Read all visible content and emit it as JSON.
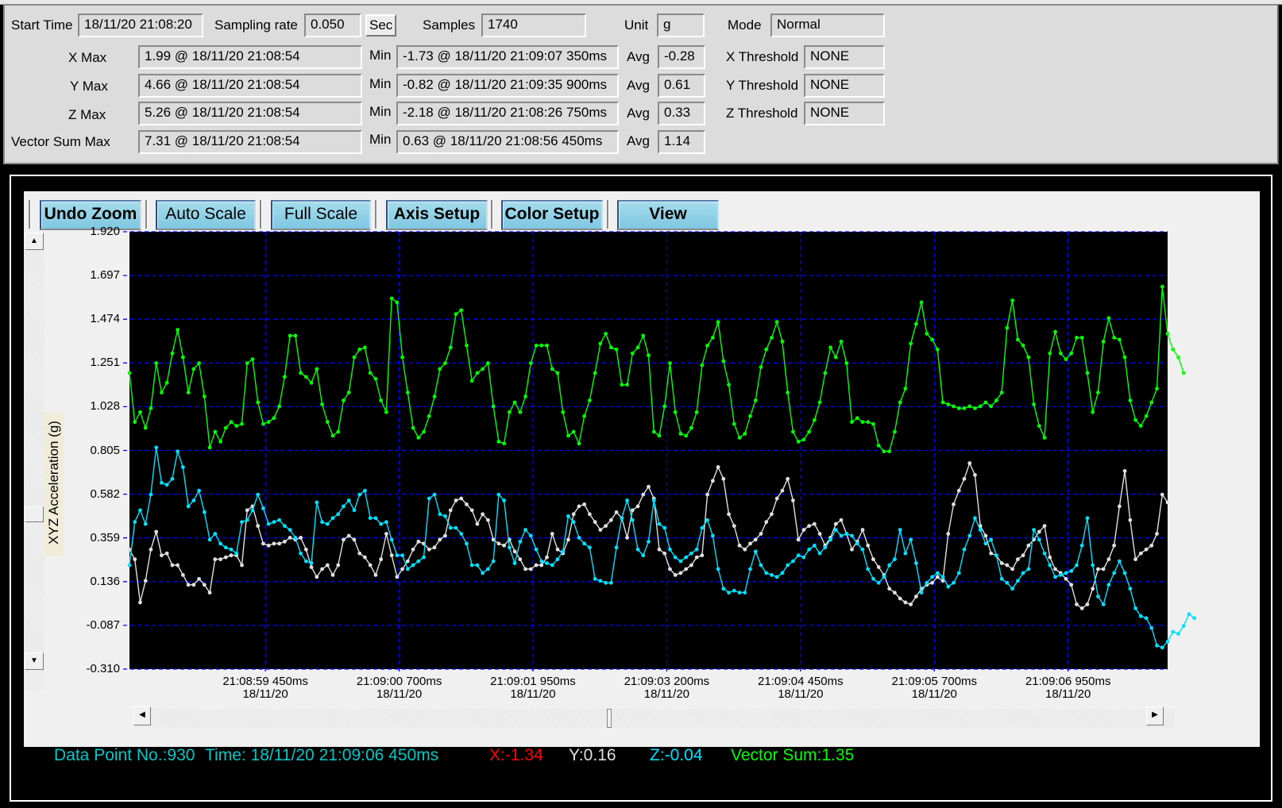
{
  "header": {
    "start_time_label": "Start Time",
    "start_time": "18/11/20 21:08:20",
    "sampling_rate_label": "Sampling rate",
    "sampling_rate": "0.050",
    "sampling_unit_button": "Sec",
    "samples_label": "Samples",
    "samples": "1740",
    "unit_label": "Unit",
    "unit": "g",
    "mode_label": "Mode",
    "mode": "Normal",
    "rows": [
      {
        "label": "X  Max",
        "max": "1.99 @ 18/11/20 21:08:54",
        "min_label": "Min",
        "min": "-1.73 @ 18/11/20 21:09:07 350ms",
        "avg_label": "Avg",
        "avg": "-0.28",
        "threshold_label": "X Threshold",
        "threshold": "NONE"
      },
      {
        "label": "Y Max",
        "max": "4.66 @ 18/11/20 21:08:54",
        "min_label": "Min",
        "min": "-0.82 @ 18/11/20 21:09:35 900ms",
        "avg_label": "Avg",
        "avg": "0.61",
        "threshold_label": "Y Threshold",
        "threshold": "NONE"
      },
      {
        "label": "Z  Max",
        "max": "5.26 @ 18/11/20 21:08:54",
        "min_label": "Min",
        "min": "-2.18 @ 18/11/20 21:08:26 750ms",
        "avg_label": "Avg",
        "avg": "0.33",
        "threshold_label": "Z Threshold",
        "threshold": "NONE"
      },
      {
        "label": "Vector Sum Max",
        "max": "7.31 @ 18/11/20 21:08:54",
        "min_label": "Min",
        "min": "0.63 @ 18/11/20 21:08:56 450ms",
        "avg_label": "Avg",
        "avg": "1.14"
      }
    ]
  },
  "toolbar": {
    "buttons": [
      "Undo Zoom",
      "Auto Scale",
      "Full Scale",
      "Axis Setup",
      "Color Setup",
      "View"
    ]
  },
  "status": {
    "data_point": "Data Point No.:930",
    "time": "Time: 18/11/20 21:09:06 450ms",
    "x": "X:-1.34",
    "y": "Y:0.16",
    "z": "Z:-0.04",
    "vector_sum": "Vector Sum:1.35",
    "colors": {
      "cyan": "#00c8c8",
      "x": "#ff0000",
      "y": "#e0e0e0",
      "z": "#00e0ff",
      "vector": "#00ff00"
    }
  },
  "chart_data": {
    "type": "line",
    "title": "",
    "ylabel": "XYZ  Acceleration (g)",
    "xlabel": "",
    "ylim": [
      -0.31,
      1.92
    ],
    "yticks": [
      "1.920",
      "1.697",
      "1.474",
      "1.251",
      "1.028",
      "0.805",
      "0.582",
      "0.359",
      "0.136",
      "-0.087",
      "-0.310"
    ],
    "xticks": [
      {
        "time": "21:08:59 450ms",
        "date": "18/11/20",
        "index": 25.4
      },
      {
        "time": "21:09:00 700ms",
        "date": "18/11/20",
        "index": 50.4
      },
      {
        "time": "21:09:01 950ms",
        "date": "18/11/20",
        "index": 75.4
      },
      {
        "time": "21:09:03 200ms",
        "date": "18/11/20",
        "index": 100.4
      },
      {
        "time": "21:09:04 450ms",
        "date": "18/11/20",
        "index": 125.4
      },
      {
        "time": "21:09:05 700ms",
        "date": "18/11/20",
        "index": 150.4
      },
      {
        "time": "21:09:06 950ms",
        "date": "18/11/20",
        "index": 175.4
      }
    ],
    "x_count": 195,
    "grid": true,
    "background": "#000000",
    "series": [
      {
        "name": "Vector Sum",
        "color": "#00ff00",
        "values": [
          1.2,
          0.95,
          1.0,
          0.92,
          1.02,
          1.25,
          1.1,
          1.15,
          1.3,
          1.42,
          1.28,
          1.1,
          1.22,
          1.25,
          1.08,
          0.82,
          0.9,
          0.85,
          0.92,
          0.95,
          0.93,
          0.94,
          1.25,
          1.27,
          1.05,
          0.94,
          0.95,
          0.97,
          1.03,
          1.18,
          1.39,
          1.39,
          1.2,
          1.18,
          1.15,
          1.22,
          1.04,
          0.95,
          0.88,
          0.9,
          1.06,
          1.1,
          1.28,
          1.32,
          1.33,
          1.2,
          1.17,
          1.06,
          1.0,
          1.58,
          1.56,
          1.28,
          1.1,
          0.92,
          0.87,
          0.9,
          0.98,
          1.08,
          1.22,
          1.25,
          1.33,
          1.5,
          1.52,
          1.34,
          1.16,
          1.2,
          1.22,
          1.25,
          1.03,
          0.85,
          0.84,
          1.0,
          1.05,
          1.0,
          1.08,
          1.25,
          1.34,
          1.34,
          1.34,
          1.22,
          1.2,
          1.0,
          0.88,
          0.9,
          0.84,
          0.98,
          1.06,
          1.2,
          1.35,
          1.4,
          1.33,
          1.32,
          1.14,
          1.14,
          1.3,
          1.33,
          1.39,
          1.29,
          0.9,
          0.88,
          1.03,
          1.25,
          1.0,
          0.89,
          0.88,
          0.92,
          1.0,
          1.24,
          1.34,
          1.38,
          1.46,
          1.26,
          1.14,
          0.94,
          0.87,
          0.89,
          0.98,
          1.06,
          1.23,
          1.32,
          1.38,
          1.46,
          1.36,
          1.1,
          0.9,
          0.85,
          0.86,
          0.9,
          0.96,
          1.05,
          1.2,
          1.33,
          1.28,
          1.36,
          1.25,
          0.95,
          0.97,
          0.95,
          0.95,
          0.94,
          0.83,
          0.8,
          0.8,
          0.9,
          1.05,
          1.12,
          1.35,
          1.45,
          1.56,
          1.4,
          1.37,
          1.32,
          1.05,
          1.04,
          1.03,
          1.02,
          1.02,
          1.03,
          1.02,
          1.03,
          1.05,
          1.03,
          1.06,
          1.1,
          1.43,
          1.57,
          1.37,
          1.34,
          1.28,
          1.04,
          0.93,
          0.87,
          1.3,
          1.41,
          1.3,
          1.27,
          1.3,
          1.38,
          1.38,
          1.2,
          1.0,
          1.1,
          1.36,
          1.48,
          1.38,
          1.37,
          1.28,
          1.06,
          0.96,
          0.93,
          0.98,
          1.05,
          1.12,
          1.64,
          1.4,
          1.32,
          1.28,
          1.2
        ]
      },
      {
        "name": "Y",
        "color": "#e0e0e0",
        "values": [
          0.3,
          0.25,
          0.03,
          0.14,
          0.3,
          0.39,
          0.27,
          0.28,
          0.22,
          0.22,
          0.17,
          0.12,
          0.12,
          0.15,
          0.12,
          0.08,
          0.25,
          0.25,
          0.26,
          0.27,
          0.27,
          0.22,
          0.5,
          0.52,
          0.42,
          0.33,
          0.32,
          0.33,
          0.33,
          0.34,
          0.36,
          0.35,
          0.36,
          0.3,
          0.21,
          0.16,
          0.2,
          0.22,
          0.17,
          0.22,
          0.35,
          0.37,
          0.35,
          0.28,
          0.26,
          0.22,
          0.17,
          0.25,
          0.38,
          0.27,
          0.16,
          0.2,
          0.24,
          0.3,
          0.34,
          0.33,
          0.3,
          0.31,
          0.35,
          0.37,
          0.5,
          0.55,
          0.56,
          0.53,
          0.5,
          0.43,
          0.48,
          0.45,
          0.35,
          0.33,
          0.32,
          0.35,
          0.29,
          0.25,
          0.2,
          0.2,
          0.22,
          0.22,
          0.26,
          0.38,
          0.3,
          0.28,
          0.35,
          0.48,
          0.52,
          0.53,
          0.48,
          0.44,
          0.4,
          0.42,
          0.45,
          0.49,
          0.46,
          0.36,
          0.5,
          0.52,
          0.58,
          0.62,
          0.56,
          0.3,
          0.28,
          0.2,
          0.17,
          0.18,
          0.2,
          0.22,
          0.26,
          0.27,
          0.58,
          0.65,
          0.72,
          0.66,
          0.48,
          0.42,
          0.32,
          0.3,
          0.33,
          0.35,
          0.38,
          0.44,
          0.48,
          0.56,
          0.6,
          0.66,
          0.55,
          0.35,
          0.4,
          0.42,
          0.43,
          0.38,
          0.32,
          0.36,
          0.43,
          0.45,
          0.38,
          0.3,
          0.34,
          0.4,
          0.32,
          0.25,
          0.21,
          0.17,
          0.1,
          0.08,
          0.05,
          0.03,
          0.02,
          0.06,
          0.1,
          0.12,
          0.13,
          0.16,
          0.14,
          0.38,
          0.53,
          0.6,
          0.66,
          0.74,
          0.68,
          0.42,
          0.37,
          0.28,
          0.27,
          0.23,
          0.22,
          0.2,
          0.25,
          0.27,
          0.32,
          0.35,
          0.39,
          0.42,
          0.26,
          0.2,
          0.18,
          0.15,
          0.12,
          0.02,
          0.0,
          0.02,
          0.1,
          0.2,
          0.2,
          0.25,
          0.32,
          0.52,
          0.7,
          0.45,
          0.25,
          0.28,
          0.3,
          0.32,
          0.38,
          0.58,
          0.54
        ]
      },
      {
        "name": "Z",
        "color": "#00e0ff",
        "values": [
          0.22,
          0.44,
          0.5,
          0.43,
          0.58,
          0.82,
          0.64,
          0.63,
          0.66,
          0.8,
          0.72,
          0.52,
          0.55,
          0.6,
          0.49,
          0.35,
          0.38,
          0.33,
          0.31,
          0.3,
          0.28,
          0.44,
          0.45,
          0.5,
          0.58,
          0.51,
          0.43,
          0.44,
          0.45,
          0.42,
          0.4,
          0.36,
          0.28,
          0.24,
          0.23,
          0.54,
          0.44,
          0.43,
          0.46,
          0.48,
          0.52,
          0.55,
          0.5,
          0.58,
          0.6,
          0.46,
          0.46,
          0.43,
          0.44,
          0.35,
          0.27,
          0.27,
          0.2,
          0.22,
          0.24,
          0.26,
          0.56,
          0.58,
          0.48,
          0.47,
          0.41,
          0.41,
          0.38,
          0.33,
          0.22,
          0.22,
          0.18,
          0.2,
          0.24,
          0.58,
          0.55,
          0.31,
          0.23,
          0.34,
          0.4,
          0.37,
          0.3,
          0.24,
          0.23,
          0.22,
          0.25,
          0.29,
          0.47,
          0.44,
          0.36,
          0.33,
          0.31,
          0.15,
          0.14,
          0.13,
          0.13,
          0.31,
          0.46,
          0.55,
          0.45,
          0.3,
          0.27,
          0.34,
          0.55,
          0.43,
          0.41,
          0.3,
          0.26,
          0.24,
          0.26,
          0.28,
          0.3,
          0.41,
          0.45,
          0.37,
          0.2,
          0.1,
          0.08,
          0.09,
          0.08,
          0.08,
          0.2,
          0.29,
          0.22,
          0.18,
          0.17,
          0.16,
          0.18,
          0.22,
          0.24,
          0.27,
          0.26,
          0.3,
          0.32,
          0.28,
          0.31,
          0.35,
          0.4,
          0.37,
          0.38,
          0.37,
          0.33,
          0.3,
          0.2,
          0.15,
          0.13,
          0.16,
          0.22,
          0.25,
          0.4,
          0.28,
          0.35,
          0.23,
          0.08,
          0.13,
          0.16,
          0.18,
          0.16,
          0.11,
          0.13,
          0.18,
          0.3,
          0.37,
          0.46,
          0.4,
          0.33,
          0.35,
          0.27,
          0.15,
          0.13,
          0.1,
          0.14,
          0.18,
          0.2,
          0.4,
          0.35,
          0.28,
          0.22,
          0.16,
          0.17,
          0.18,
          0.19,
          0.22,
          0.32,
          0.46,
          0.22,
          0.06,
          0.02,
          0.12,
          0.18,
          0.24,
          0.18,
          0.1,
          0.0,
          -0.04,
          -0.05,
          -0.1,
          -0.19,
          -0.2,
          -0.17,
          -0.12,
          -0.13,
          -0.09,
          -0.03,
          -0.05
        ]
      }
    ]
  }
}
